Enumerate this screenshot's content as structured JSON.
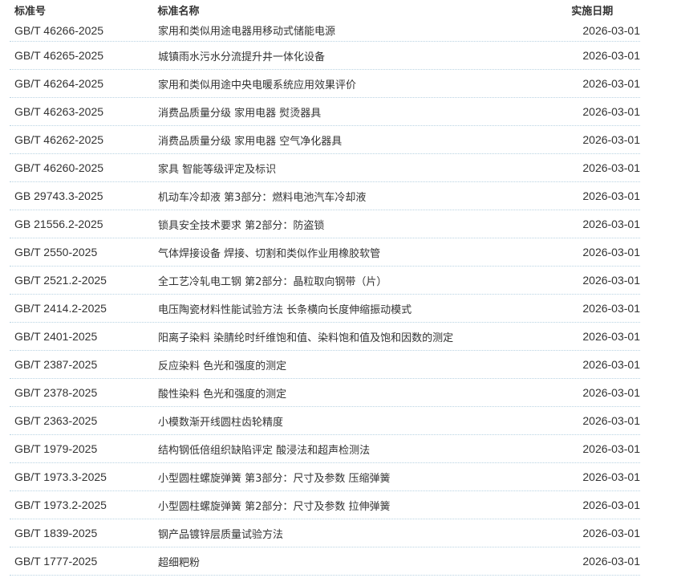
{
  "table": {
    "headers": {
      "code": "标准号",
      "name": "标准名称",
      "date": "实施日期"
    },
    "rows": [
      {
        "code": "GB/T 46266-2025",
        "name": "家用和类似用途电器用移动式储能电源",
        "date": "2026-03-01"
      },
      {
        "code": "GB/T 46265-2025",
        "name": "城镇雨水污水分流提升井一体化设备",
        "date": "2026-03-01"
      },
      {
        "code": "GB/T 46264-2025",
        "name": "家用和类似用途中央电暖系统应用效果评价",
        "date": "2026-03-01"
      },
      {
        "code": "GB/T 46263-2025",
        "name": "消费品质量分级 家用电器 熨烫器具",
        "date": "2026-03-01"
      },
      {
        "code": "GB/T 46262-2025",
        "name": "消费品质量分级 家用电器 空气净化器具",
        "date": "2026-03-01"
      },
      {
        "code": "GB/T 46260-2025",
        "name": "家具 智能等级评定及标识",
        "date": "2026-03-01"
      },
      {
        "code": "GB 29743.3-2025",
        "name": "机动车冷却液 第3部分：燃料电池汽车冷却液",
        "date": "2026-03-01"
      },
      {
        "code": "GB 21556.2-2025",
        "name": "锁具安全技术要求 第2部分：防盗锁",
        "date": "2026-03-01"
      },
      {
        "code": "GB/T 2550-2025",
        "name": "气体焊接设备 焊接、切割和类似作业用橡胶软管",
        "date": "2026-03-01"
      },
      {
        "code": "GB/T 2521.2-2025",
        "name": "全工艺冷轧电工钢 第2部分：晶粒取向钢带（片）",
        "date": "2026-03-01"
      },
      {
        "code": "GB/T 2414.2-2025",
        "name": "电压陶瓷材料性能试验方法 长条横向长度伸缩振动模式",
        "date": "2026-03-01"
      },
      {
        "code": "GB/T 2401-2025",
        "name": "阳离子染料 染腈纶时纤维饱和值、染料饱和值及饱和因数的测定",
        "date": "2026-03-01"
      },
      {
        "code": "GB/T 2387-2025",
        "name": "反应染料 色光和强度的测定",
        "date": "2026-03-01"
      },
      {
        "code": "GB/T 2378-2025",
        "name": "酸性染料 色光和强度的测定",
        "date": "2026-03-01"
      },
      {
        "code": "GB/T 2363-2025",
        "name": "小模数渐开线圆柱齿轮精度",
        "date": "2026-03-01"
      },
      {
        "code": "GB/T 1979-2025",
        "name": "结构钢低倍组织缺陷评定 酸浸法和超声检测法",
        "date": "2026-03-01"
      },
      {
        "code": "GB/T 1973.3-2025",
        "name": "小型圆柱螺旋弹簧 第3部分：尺寸及参数 压缩弹簧",
        "date": "2026-03-01"
      },
      {
        "code": "GB/T 1973.2-2025",
        "name": "小型圆柱螺旋弹簧 第2部分：尺寸及参数 拉伸弹簧",
        "date": "2026-03-01"
      },
      {
        "code": "GB/T 1839-2025",
        "name": "钢产品镀锌层质量试验方法",
        "date": "2026-03-01"
      },
      {
        "code": "GB/T 1777-2025",
        "name": "超细粑粉",
        "date": "2026-03-01"
      }
    ]
  }
}
